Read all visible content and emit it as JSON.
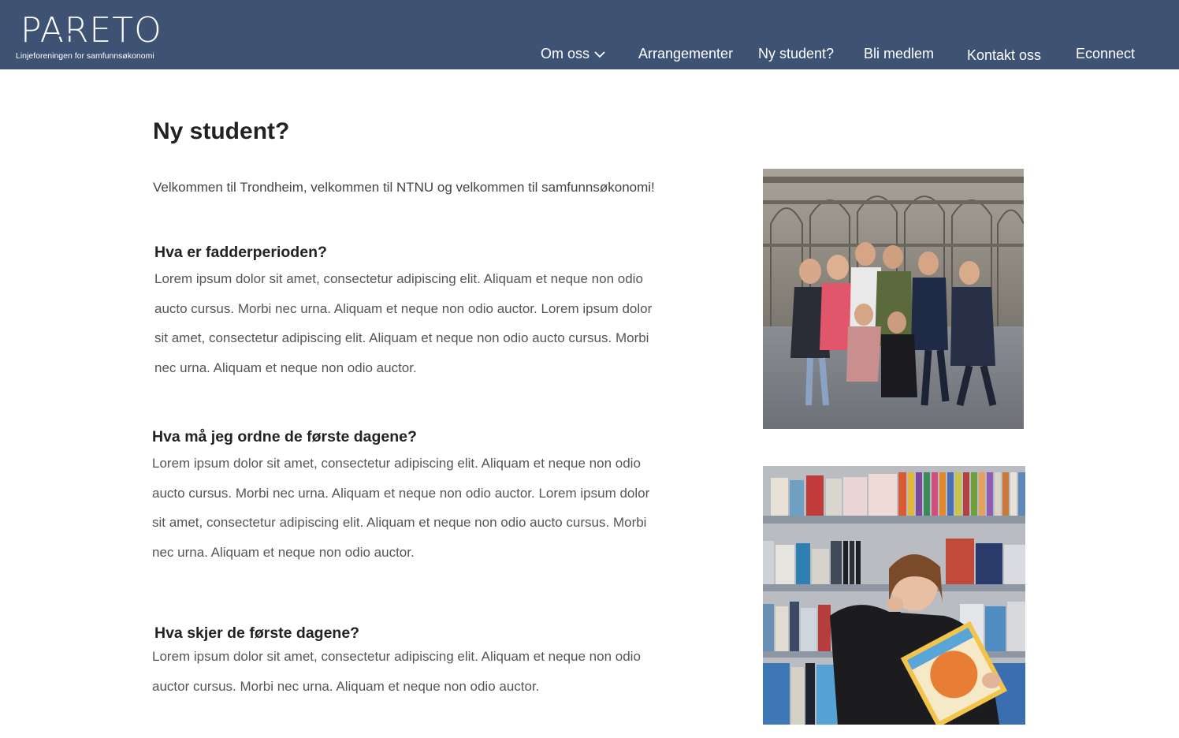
{
  "brand": {
    "name": "PARETO",
    "tagline": "Linjeforeningen for samfunnsøkonomi",
    "nav_bg": "#3e5274"
  },
  "nav": {
    "items": [
      {
        "label": "Om oss",
        "has_dropdown": true
      },
      {
        "label": "Arrangementer"
      },
      {
        "label": "Ny student?"
      },
      {
        "label": "Bli medlem"
      },
      {
        "label": "Kontakt oss"
      },
      {
        "label": "Econnect"
      }
    ]
  },
  "main": {
    "title": "Ny student?",
    "intro": "Velkommen til Trondheim, velkommen til NTNU og velkommen til samfunnsøkonomi!",
    "sections": [
      {
        "heading": "Hva er fadderperioden?",
        "body": "Lorem ipsum dolor sit amet, consectetur adipiscing elit. Aliquam et neque non odio\n auctо cursus. Morbi nec urna. Aliquam et neque non odio auctor. Lorem ipsum dolor\nsit amet, consectetur adipiscing elit. Aliquam et neque non odio aucto cursus. Morbi\nnec urna. Aliquam et neque non odio auctor."
      },
      {
        "heading": "Hva må jeg ordne de første dagene?",
        "body": "Lorem ipsum dolor sit amet, consectetur adipiscing elit. Aliquam et neque non odio\n aucto cursus. Morbi nec urna. Aliquam et neque non odio auctor. Lorem ipsum dolor\nsit amet, consectetur adipiscing elit. Aliquam et neque non odio aucto cursus. Morbi\nnec urna. Aliquam et neque non odio auctor."
      },
      {
        "heading": "Hva skjer de første dagene?",
        "body": "Lorem ipsum dolor sit amet, consectetur adipiscing elit. Aliquam et neque non odio\n auctor cursus. Morbi nec urna. Aliquam et neque non odio auctor."
      }
    ]
  },
  "images": {
    "photo1": "group-photo",
    "photo2": "bookstore-photo"
  }
}
